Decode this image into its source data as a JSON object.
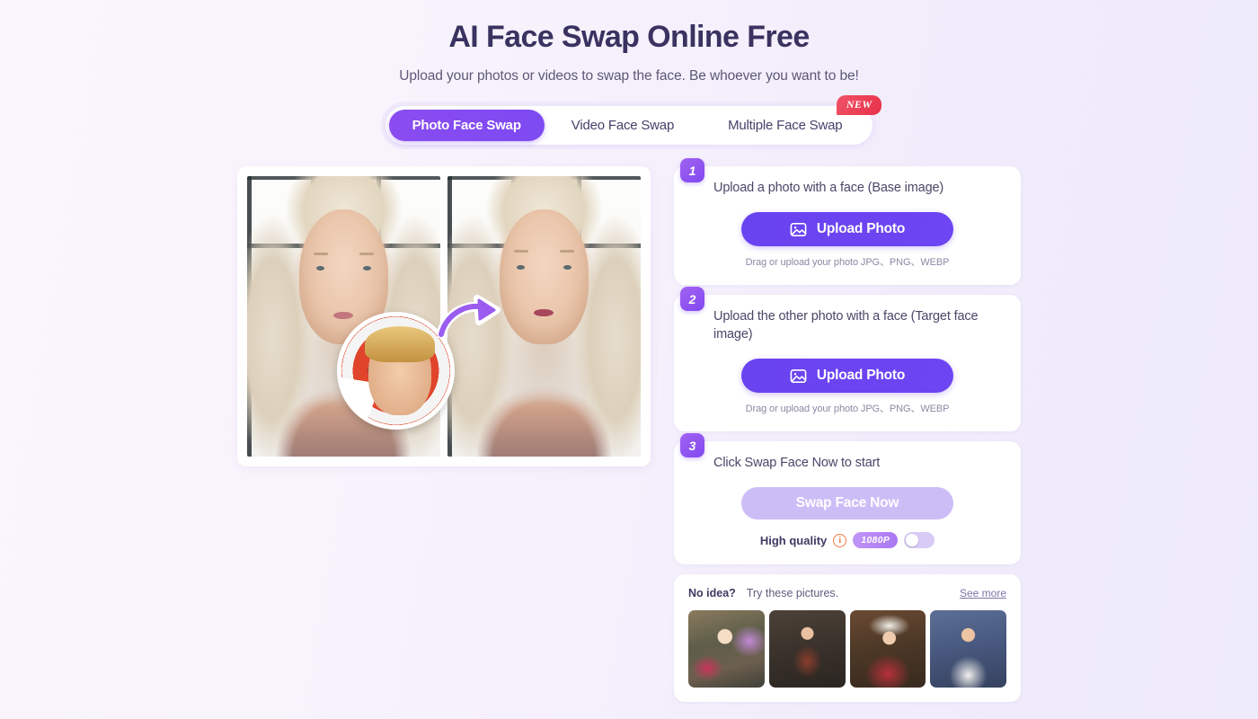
{
  "header": {
    "title": "AI Face Swap Online Free",
    "subtitle": "Upload your photos or videos to swap the face. Be whoever you want to be!"
  },
  "tabs": [
    {
      "label": "Photo Face Swap",
      "active": true
    },
    {
      "label": "Video Face Swap",
      "active": false
    },
    {
      "label": "Multiple Face Swap",
      "active": false,
      "badge": "NEW"
    }
  ],
  "preview": {
    "before_alt": "Woman with long blonde braided hair, original face",
    "after_alt": "Same woman with swapped face result",
    "bubble_alt": "Circular source face thumbnail of a man in front of a shield",
    "arrow_alt": "curved arrow pointing from source face to result"
  },
  "steps": [
    {
      "number": "1",
      "title": "Upload a photo with a face (Base image)",
      "button_label": "Upload Photo",
      "hint": "Drag or upload your photo JPG、PNG、WEBP"
    },
    {
      "number": "2",
      "title": "Upload the other photo with a face (Target face image)",
      "button_label": "Upload Photo",
      "hint": "Drag or upload your photo JPG、PNG、WEBP"
    },
    {
      "number": "3",
      "title": "Click Swap Face Now to start",
      "button_label": "Swap Face Now",
      "quality_label": "High quality",
      "info_glyph": "i",
      "resolution_badge": "1080P",
      "toggle_state": "off"
    }
  ],
  "samples": {
    "title": "No idea?",
    "subtitle": "Try these pictures.",
    "see_more": "See more",
    "thumbnails": [
      {
        "alt": "Fairytale princess with floral crown"
      },
      {
        "alt": "Warrior woman in golden armor"
      },
      {
        "alt": "Woman in santa hat by christmas tree"
      },
      {
        "alt": "Student in white shirt and red tie"
      }
    ]
  },
  "colors": {
    "accent": "#6d45f2",
    "accent_light": "#8048ef",
    "badge_red": "#e8324b",
    "info_orange": "#ef7a45",
    "disabled_purple": "#cdbdf7",
    "page_bg": "#f7f3fc",
    "title": "#3a3260"
  }
}
